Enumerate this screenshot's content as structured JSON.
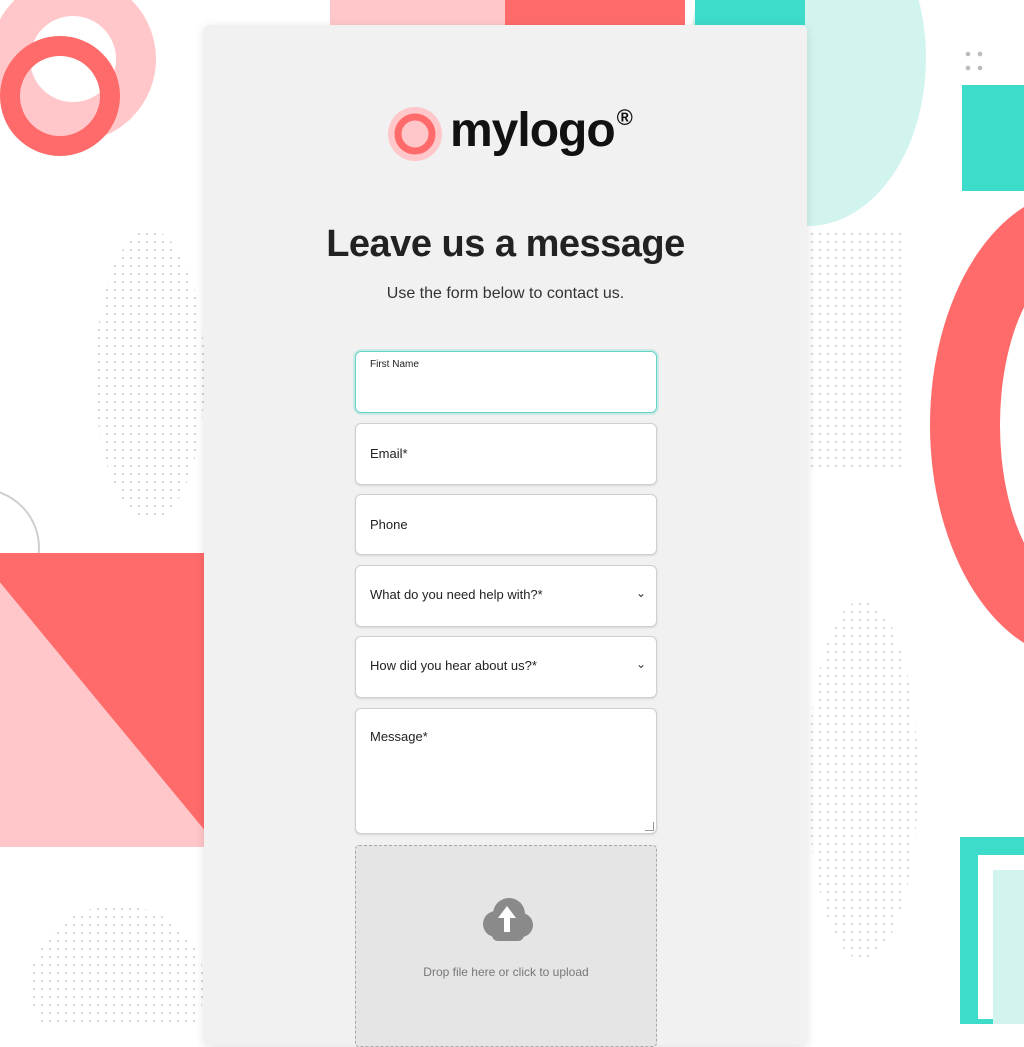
{
  "brand": {
    "name": "mylogo",
    "registered": "®"
  },
  "header": {
    "title": "Leave us a message",
    "subtitle": "Use the form below to contact us."
  },
  "form": {
    "first_name_label": "First Name",
    "email_label": "Email*",
    "phone_label": "Phone",
    "help_select_label": "What do you need help with?*",
    "hear_select_label": "How did you hear about us?*",
    "message_label": "Message*",
    "upload_text": "Drop file here or click to upload"
  },
  "icons": [
    "logo-mark-icon",
    "chevron-down-icon",
    "cloud-upload-icon"
  ],
  "colors": {
    "coral": "#ff6b6b",
    "pink": "#ffc7ca",
    "teal": "#3ddbc9",
    "light_teal": "#d2f4ef",
    "card": "#f1f1f1",
    "focus_border": "#5fd5c4"
  }
}
